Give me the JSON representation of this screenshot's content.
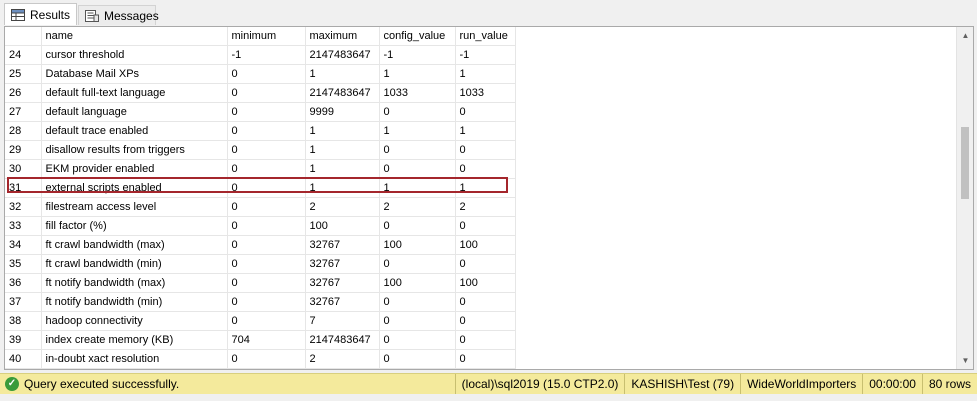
{
  "tabs": [
    {
      "label": "Results",
      "icon": "grid-icon",
      "active": true
    },
    {
      "label": "Messages",
      "icon": "messages-icon",
      "active": false
    }
  ],
  "grid": {
    "columns": [
      "",
      "name",
      "minimum",
      "maximum",
      "config_value",
      "run_value"
    ],
    "rows": [
      [
        "24",
        "cursor threshold",
        "-1",
        "2147483647",
        "-1",
        "-1"
      ],
      [
        "25",
        "Database Mail XPs",
        "0",
        "1",
        "1",
        "1"
      ],
      [
        "26",
        "default full-text language",
        "0",
        "2147483647",
        "1033",
        "1033"
      ],
      [
        "27",
        "default language",
        "0",
        "9999",
        "0",
        "0"
      ],
      [
        "28",
        "default trace enabled",
        "0",
        "1",
        "1",
        "1"
      ],
      [
        "29",
        "disallow results from triggers",
        "0",
        "1",
        "0",
        "0"
      ],
      [
        "30",
        "EKM provider enabled",
        "0",
        "1",
        "0",
        "0"
      ],
      [
        "31",
        "external scripts enabled",
        "0",
        "1",
        "1",
        "1"
      ],
      [
        "32",
        "filestream access level",
        "0",
        "2",
        "2",
        "2"
      ],
      [
        "33",
        "fill factor (%)",
        "0",
        "100",
        "0",
        "0"
      ],
      [
        "34",
        "ft crawl bandwidth (max)",
        "0",
        "32767",
        "100",
        "100"
      ],
      [
        "35",
        "ft crawl bandwidth (min)",
        "0",
        "32767",
        "0",
        "0"
      ],
      [
        "36",
        "ft notify bandwidth (max)",
        "0",
        "32767",
        "100",
        "100"
      ],
      [
        "37",
        "ft notify bandwidth (min)",
        "0",
        "32767",
        "0",
        "0"
      ],
      [
        "38",
        "hadoop connectivity",
        "0",
        "7",
        "0",
        "0"
      ],
      [
        "39",
        "index create memory (KB)",
        "704",
        "2147483647",
        "0",
        "0"
      ],
      [
        "40",
        "in-doubt xact resolution",
        "0",
        "2",
        "0",
        "0"
      ]
    ],
    "highlighted_row": "31"
  },
  "status": {
    "message": "Query executed successfully.",
    "server": "(local)\\sql2019 (15.0 CTP2.0)",
    "user": "KASHISH\\Test (79)",
    "database": "WideWorldImporters",
    "elapsed": "00:00:00",
    "rows": "80 rows"
  },
  "colors": {
    "status_bg": "#f4ea9c",
    "highlight_border": "#a4262c",
    "success_icon": "#3a9b3a"
  }
}
